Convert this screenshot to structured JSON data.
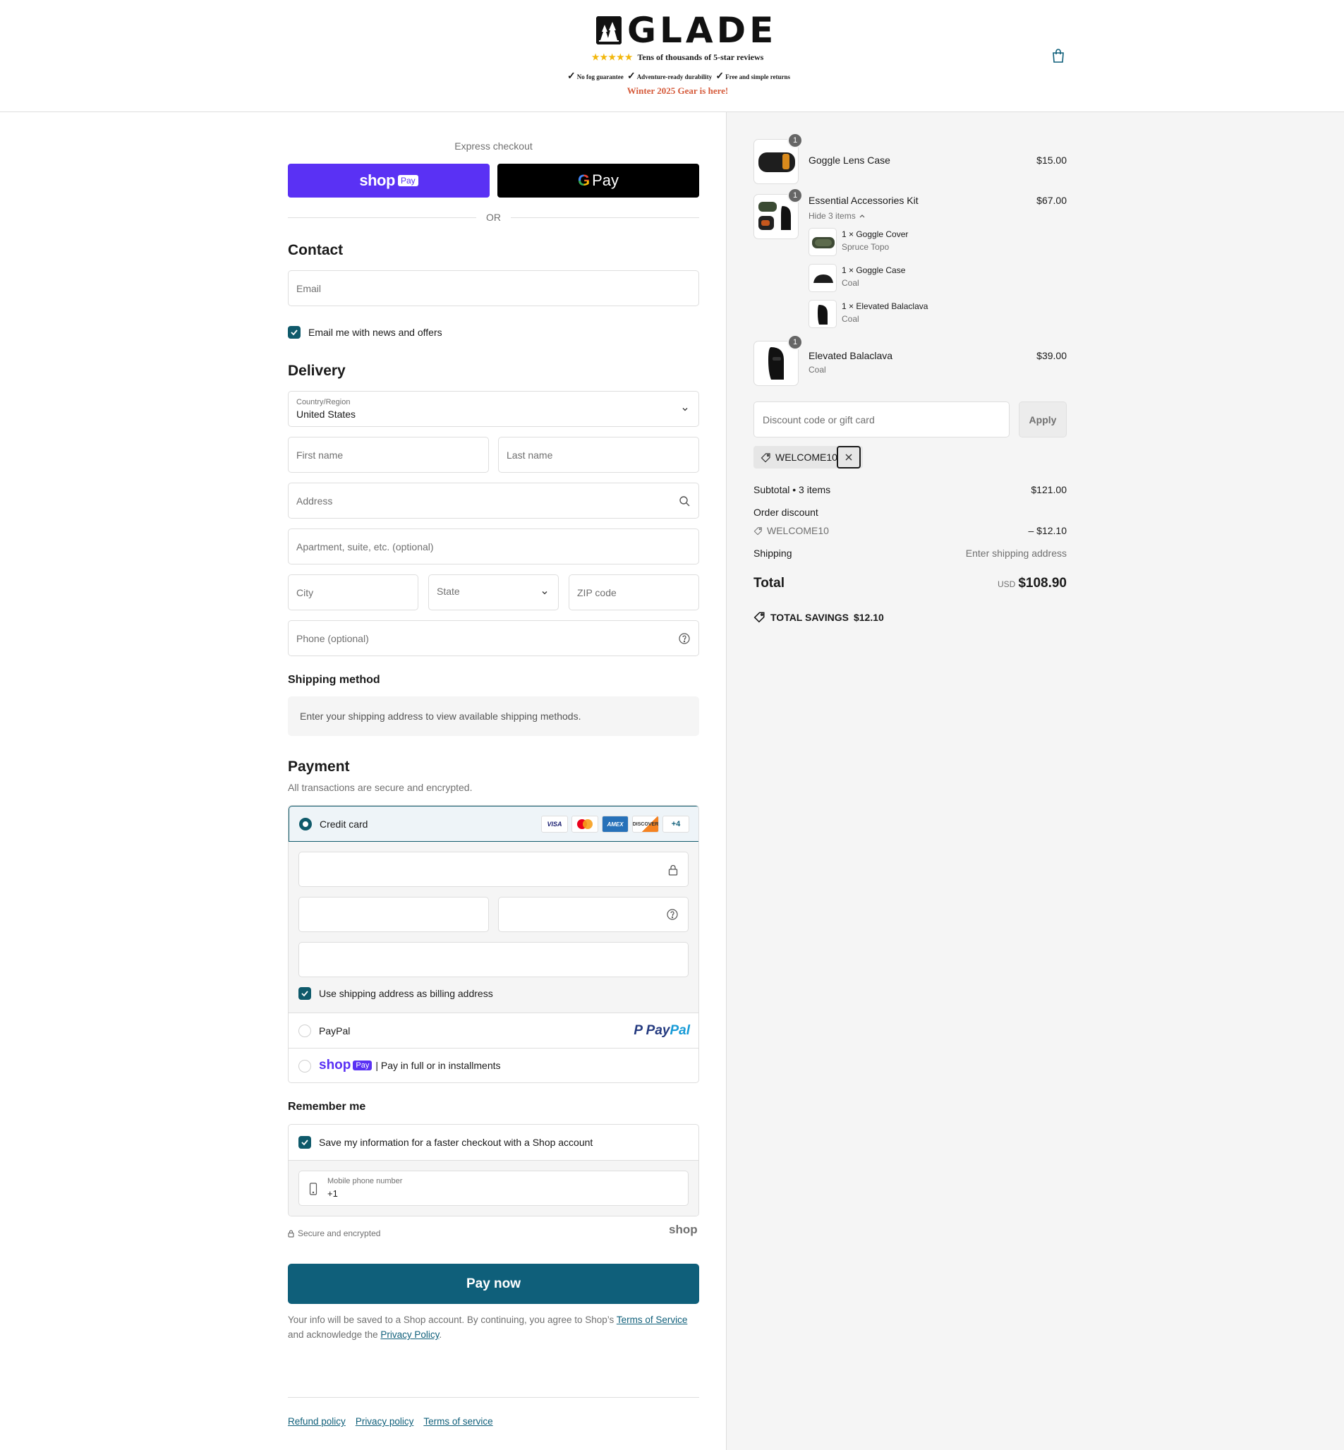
{
  "header": {
    "brand": "GLADE",
    "reviews": "Tens of thousands of 5-star reviews",
    "stars": "★★★★★",
    "perks": [
      "No fog guarantee",
      "Adventure-ready durability",
      "Free and simple returns"
    ],
    "promo": "Winter 2025 Gear is here!"
  },
  "express": {
    "title": "Express checkout",
    "shop_pay_word": "shop",
    "shop_pay_badge": "Pay",
    "gpay_g": "G",
    "gpay_label": "Pay",
    "or": "OR"
  },
  "contact": {
    "heading": "Contact",
    "email_placeholder": "Email",
    "newsletter_label": "Email me with news and offers"
  },
  "delivery": {
    "heading": "Delivery",
    "country_label": "Country/Region",
    "country_value": "United States",
    "first_name": "First name",
    "last_name": "Last name",
    "address": "Address",
    "apartment": "Apartment, suite, etc. (optional)",
    "city": "City",
    "state": "State",
    "zip": "ZIP code",
    "phone": "Phone (optional)"
  },
  "shipping_method": {
    "heading": "Shipping method",
    "notice": "Enter your shipping address to view available shipping methods."
  },
  "payment": {
    "heading": "Payment",
    "subtitle": "All transactions are secure and encrypted.",
    "credit_card_label": "Credit card",
    "card_logos": [
      "VISA",
      "MC",
      "AMEX",
      "DISCOVER"
    ],
    "more_cards": "+4",
    "billing_same_label": "Use shipping address as billing address",
    "paypal_label": "PayPal",
    "paypal_logo_1": "Pay",
    "paypal_logo_2": "Pal",
    "shop_pay_word": "shop",
    "shop_pay_badge": "Pay",
    "shop_pay_text": "| Pay in full or in installments"
  },
  "remember": {
    "heading": "Remember me",
    "save_label": "Save my information for a faster checkout with a Shop account",
    "phone_label": "Mobile phone number",
    "phone_value": "+1",
    "secure_text": "Secure and encrypted",
    "shop_logo": "shop"
  },
  "pay_now": "Pay now",
  "legal": {
    "text_1": "Your info will be saved to a Shop account. By continuing, you agree to Shop’s ",
    "terms_link": "Terms of Service",
    "text_2": "and acknowledge the ",
    "privacy_link": "Privacy Policy",
    "text_3": "."
  },
  "footer_links": [
    "Refund policy",
    "Privacy policy",
    "Terms of service"
  ],
  "summary": {
    "items": [
      {
        "qty": "1",
        "name": "Goggle Lens Case",
        "price": "$15.00"
      },
      {
        "qty": "1",
        "name": "Essential Accessories Kit",
        "price": "$67.00",
        "toggle": "Hide 3 items",
        "components": [
          {
            "name": "1 × Goggle Cover",
            "variant": "Spruce Topo"
          },
          {
            "name": "1 × Goggle Case",
            "variant": "Coal"
          },
          {
            "name": "1 × Elevated Balaclava",
            "variant": "Coal"
          }
        ]
      },
      {
        "qty": "1",
        "name": "Elevated Balaclava",
        "variant": "Coal",
        "price": "$39.00"
      }
    ],
    "discount_placeholder": "Discount code or gift card",
    "apply": "Apply",
    "applied_code": "WELCOME10",
    "subtotal_label": "Subtotal • 3 items",
    "subtotal_value": "$121.00",
    "order_discount_label": "Order discount",
    "discount_code": "WELCOME10",
    "discount_value": "– $12.10",
    "shipping_label": "Shipping",
    "shipping_value": "Enter shipping address",
    "total_label": "Total",
    "currency": "USD",
    "total_value": "$108.90",
    "savings_label": "TOTAL SAVINGS",
    "savings_value": "$12.10"
  },
  "colors": {
    "primary": "#0f5f7a",
    "shop_purple": "#5a31f4",
    "promo_red": "#d55a3a",
    "star_gold": "#f2b70c"
  }
}
